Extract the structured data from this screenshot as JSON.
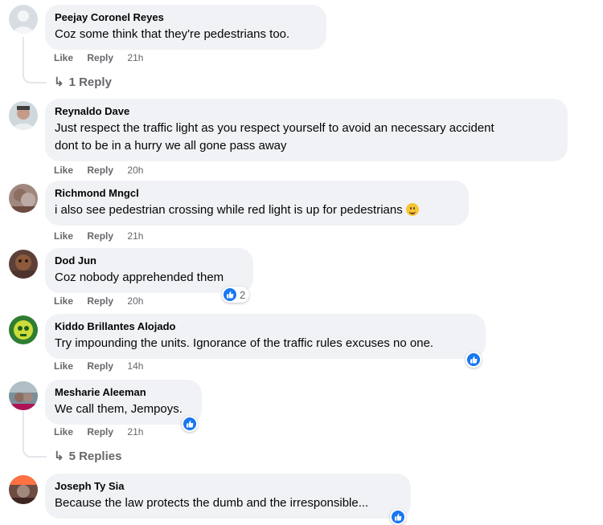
{
  "actions": {
    "like": "Like",
    "reply": "Reply"
  },
  "comments": [
    {
      "author": "Peejay Coronel Reyes",
      "text": "Coz some think that they're pedestrians too.",
      "time": "21h",
      "replies": "1 Reply"
    },
    {
      "author": "Reynaldo Dave",
      "text": "Just respect the traffic light as you respect yourself to avoid an necessary accident\ndont to be in a hurry we all gone pass away",
      "time": "20h"
    },
    {
      "author": "Richmond Mngcl",
      "text": "i also see pedestrian crossing while red light is up for pedestrians",
      "time": "21h"
    },
    {
      "author": "Dod Jun",
      "text": "Coz nobody apprehended them",
      "time": "20h",
      "reaction_count": "2"
    },
    {
      "author": "Kiddo Brillantes Alojado",
      "text": "Try impounding the units. Ignorance of the traffic rules excuses no one.",
      "time": "14h"
    },
    {
      "author": "Mesharie Aleeman",
      "text": "We call them, Jempoys.",
      "time": "21h",
      "replies": "5 Replies"
    },
    {
      "author": "Joseph Ty Sia",
      "text": "Because the law protects the dumb and the irresponsible..."
    }
  ],
  "colors": {
    "bubble": "#f0f2f5",
    "secondary_text": "#65676b",
    "like_blue": "#1877f2"
  }
}
